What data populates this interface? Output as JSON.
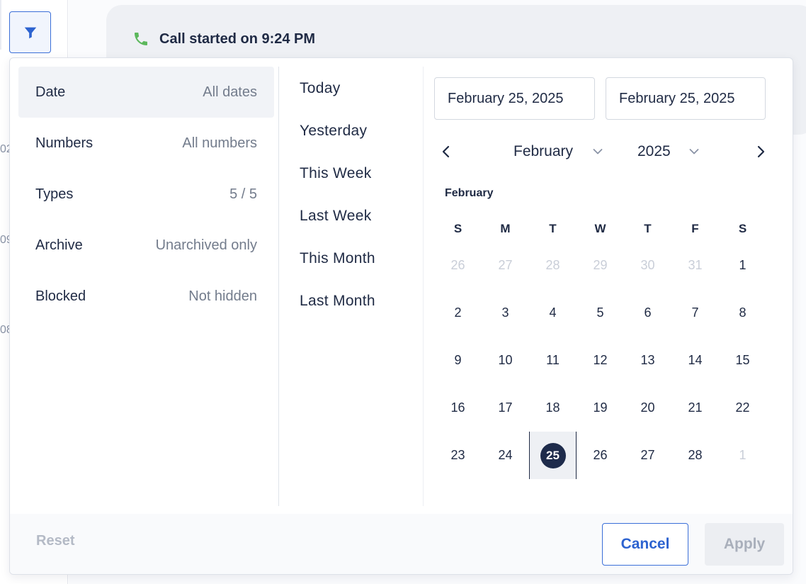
{
  "background": {
    "call_status": "Call started on 9:24 PM",
    "fragments": [
      "02",
      "09",
      "08"
    ]
  },
  "filters": [
    {
      "name": "Date",
      "value": "All dates"
    },
    {
      "name": "Numbers",
      "value": "All numbers"
    },
    {
      "name": "Types",
      "value": "5 / 5"
    },
    {
      "name": "Archive",
      "value": "Unarchived only"
    },
    {
      "name": "Blocked",
      "value": "Not hidden"
    }
  ],
  "presets": [
    "Today",
    "Yesterday",
    "This Week",
    "Last Week",
    "This Month",
    "Last Month"
  ],
  "calendar": {
    "start_date": "February 25, 2025",
    "end_date": "February 25, 2025",
    "month_select": "February",
    "year_select": "2025",
    "month_label": "February",
    "weekdays": [
      "S",
      "M",
      "T",
      "W",
      "T",
      "F",
      "S"
    ],
    "weeks": [
      [
        "26",
        "27",
        "28",
        "29",
        "30",
        "31",
        "1"
      ],
      [
        "2",
        "3",
        "4",
        "5",
        "6",
        "7",
        "8"
      ],
      [
        "9",
        "10",
        "11",
        "12",
        "13",
        "14",
        "15"
      ],
      [
        "16",
        "17",
        "18",
        "19",
        "20",
        "21",
        "22"
      ],
      [
        "23",
        "24",
        "25",
        "26",
        "27",
        "28",
        "1"
      ]
    ],
    "selected_day": "25"
  },
  "footer": {
    "reset_label": "Reset",
    "cancel_label": "Cancel",
    "apply_label": "Apply"
  },
  "colors": {
    "accent": "#2d63d0",
    "selected_day": "#1e2b4b",
    "phone_icon": "#5cb85c"
  }
}
